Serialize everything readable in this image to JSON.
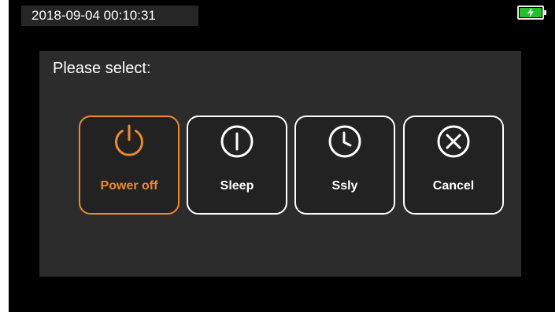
{
  "status_bar": {
    "datetime": "2018-09-04  00:10:31",
    "battery_icon": "battery-charging-icon",
    "battery_color": "#22c02a"
  },
  "dialog": {
    "title": "Please select:",
    "options": [
      {
        "label": "Power off",
        "icon": "power-icon",
        "selected": true
      },
      {
        "label": "Sleep",
        "icon": "sleep-icon",
        "selected": false
      },
      {
        "label": "Ssly",
        "icon": "clock-icon",
        "selected": false
      },
      {
        "label": "Cancel",
        "icon": "close-circle-icon",
        "selected": false
      }
    ]
  },
  "colors": {
    "accent": "#ec8a2c",
    "dialog_bg": "#2c2c2c",
    "screen_bg": "#000000"
  }
}
